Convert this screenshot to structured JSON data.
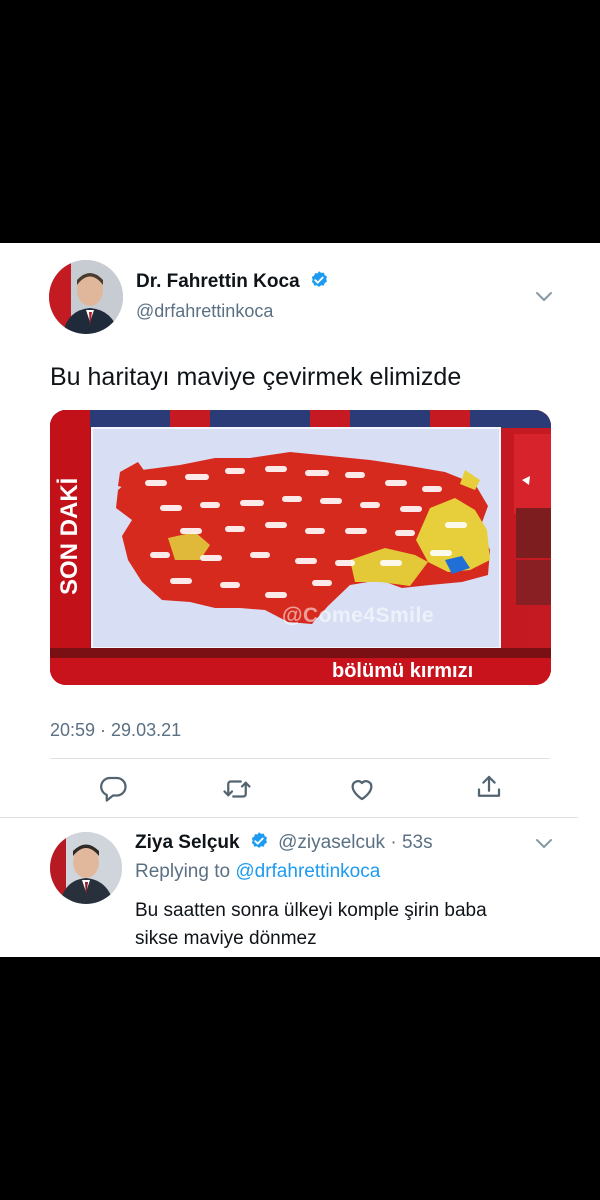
{
  "tweet": {
    "author_name": "Dr. Fahrettin Koca",
    "author_handle": "@drfahrettinkoca",
    "text": "Bu haritayı maviye çevirmek elimizde",
    "timestamp": "20:59 · 29.03.21",
    "media": {
      "side_banner": "SON DAKİ",
      "watermark": "@Come4Smile",
      "bottom_ticker": "bölümü kırmızı"
    }
  },
  "reply": {
    "author_name": "Ziya Selçuk",
    "author_handle": "@ziyaselcuk",
    "age": "· 53s",
    "replying_prefix": "Replying to",
    "replying_to": "@drfahrettinkoca",
    "text_line1": "Bu saatten sonra ülkeyi komple şirin baba",
    "text_line2": "sikse maviye dönmez"
  },
  "icons": {
    "verified": "verified-badge-icon",
    "more": "chevron-down-icon",
    "reply": "reply-icon",
    "retweet": "retweet-icon",
    "like": "heart-icon",
    "share": "share-icon"
  },
  "colors": {
    "verified_blue": "#1d9bf0",
    "link_blue": "#1d9bf0",
    "map_red": "#d72a1e",
    "map_yellow": "#e6cf3a",
    "map_blue": "#1f6fd6",
    "background": "#000000"
  }
}
